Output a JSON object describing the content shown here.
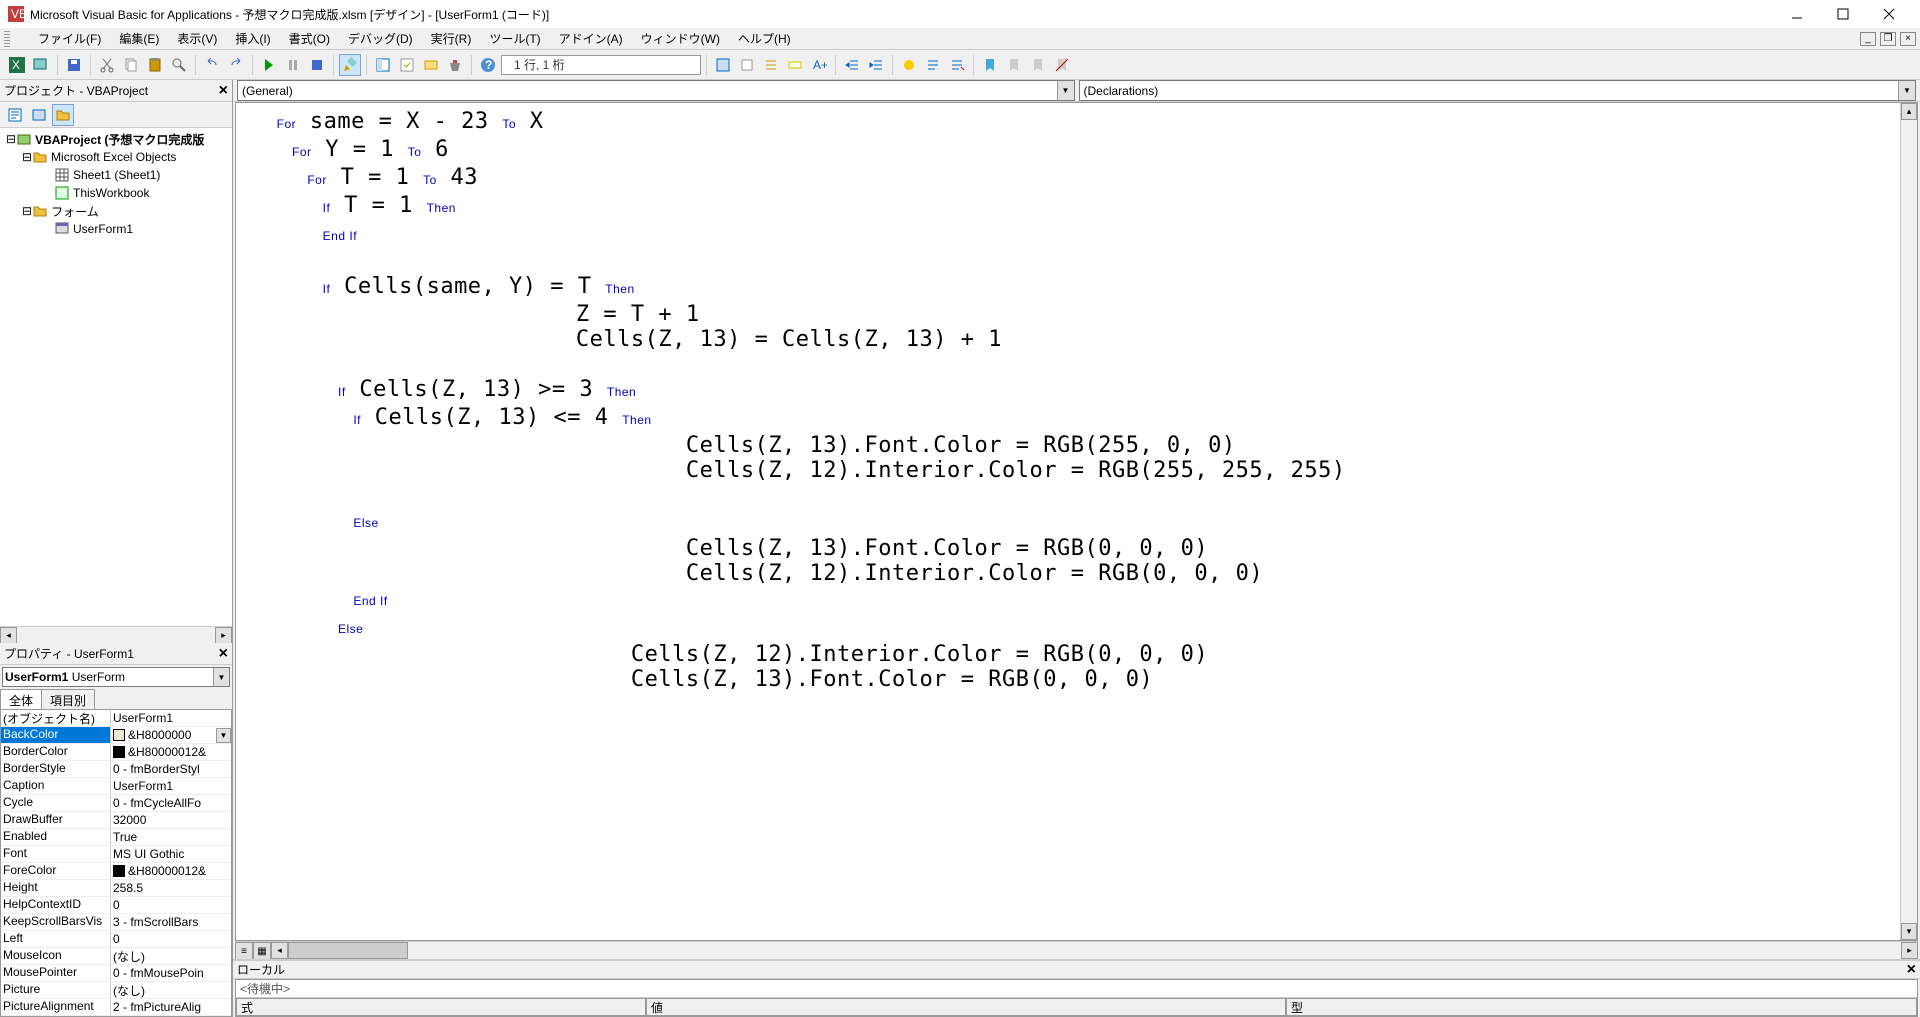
{
  "title": "Microsoft Visual Basic for Applications - 予想マクロ完成版.xlsm [デザイン] - [UserForm1 (コード)]",
  "menu": {
    "file": "ファイル(F)",
    "edit": "編集(E)",
    "view": "表示(V)",
    "insert": "挿入(I)",
    "format": "書式(O)",
    "debug": "デバッグ(D)",
    "run": "実行(R)",
    "tools": "ツール(T)",
    "addins": "アドイン(A)",
    "window": "ウィンドウ(W)",
    "help": "ヘルプ(H)"
  },
  "toolbar": {
    "position": "1 行, 1 桁"
  },
  "projectPane": {
    "title": "プロジェクト - VBAProject",
    "root": "VBAProject (予想マクロ完成版",
    "excelObjects": "Microsoft Excel Objects",
    "sheet1": "Sheet1 (Sheet1)",
    "thisWorkbook": "ThisWorkbook",
    "forms": "フォーム",
    "userForm": "UserForm1"
  },
  "propPane": {
    "title": "プロパティ - UserForm1",
    "objName": "UserForm1",
    "objType": "UserForm",
    "tabAll": "全体",
    "tabCat": "項目別",
    "rows": [
      {
        "n": "(オブジェクト名)",
        "v": "UserForm1"
      },
      {
        "n": "BackColor",
        "v": "&H8000000",
        "c": "#ece9d8",
        "sel": true,
        "dd": true
      },
      {
        "n": "BorderColor",
        "v": "&H80000012&",
        "c": "#000000"
      },
      {
        "n": "BorderStyle",
        "v": "0 - fmBorderStyl"
      },
      {
        "n": "Caption",
        "v": "UserForm1"
      },
      {
        "n": "Cycle",
        "v": "0 - fmCycleAllFo"
      },
      {
        "n": "DrawBuffer",
        "v": "32000"
      },
      {
        "n": "Enabled",
        "v": "True"
      },
      {
        "n": "Font",
        "v": "MS UI Gothic"
      },
      {
        "n": "ForeColor",
        "v": "&H80000012&",
        "c": "#000000"
      },
      {
        "n": "Height",
        "v": "258.5"
      },
      {
        "n": "HelpContextID",
        "v": "0"
      },
      {
        "n": "KeepScrollBarsVis",
        "v": "3 - fmScrollBars"
      },
      {
        "n": "Left",
        "v": "0"
      },
      {
        "n": "MouseIcon",
        "v": "(なし)"
      },
      {
        "n": "MousePointer",
        "v": "0 - fmMousePoin"
      },
      {
        "n": "Picture",
        "v": "(なし)"
      },
      {
        "n": "PictureAlignment",
        "v": "2 - fmPictureAlig"
      }
    ]
  },
  "combos": {
    "left": "(General)",
    "right": "(Declarations)"
  },
  "locals": {
    "title": "ローカル",
    "ready": "<待機中>",
    "col1": "式",
    "col2": "値",
    "col3": "型"
  },
  "code": {
    "l1a": "        For",
    "l1b": " same = X - 23 ",
    "l1c": "To",
    "l1d": " X",
    "l2a": "            For",
    "l2b": " Y = 1 ",
    "l2c": "To",
    "l2d": " 6",
    "l3a": "                For",
    "l3b": " T = 1 ",
    "l3c": "To",
    "l3d": " 43",
    "l4a": "                    If",
    "l4b": " T = 1 ",
    "l4c": "Then",
    "l5a": "                    End If",
    "l7a": "                    If",
    "l7b": " Cells(same, Y) = T ",
    "l7c": "Then",
    "l8": "                        Z = T + 1",
    "l9": "                        Cells(Z, 13) = Cells(Z, 13) + 1",
    "l11a": "                        If",
    "l11b": " Cells(Z, 13) >= 3 ",
    "l11c": "Then",
    "l12a": "                            If",
    "l12b": " Cells(Z, 13) <= 4 ",
    "l12c": "Then",
    "l13": "                                Cells(Z, 13).Font.Color = RGB(255, 0, 0)",
    "l14": "                                Cells(Z, 12).Interior.Color = RGB(255, 255, 255)",
    "l16a": "                            Else",
    "l17": "                                Cells(Z, 13).Font.Color = RGB(0, 0, 0)",
    "l18": "                                Cells(Z, 12).Interior.Color = RGB(0, 0, 0)",
    "l19a": "                            End If",
    "l20a": "                        Else",
    "l21": "                            Cells(Z, 12).Interior.Color = RGB(0, 0, 0)",
    "l22": "                            Cells(Z, 13).Font.Color = RGB(0, 0, 0)"
  }
}
